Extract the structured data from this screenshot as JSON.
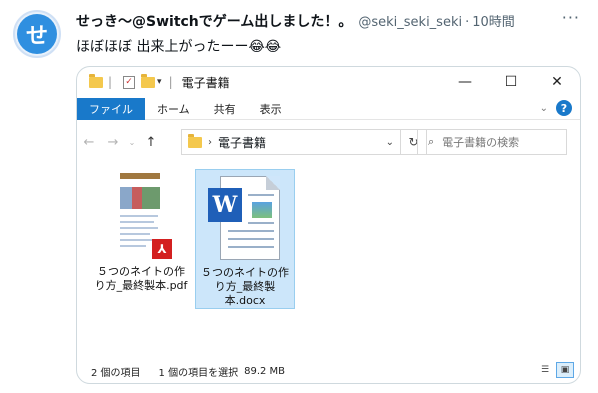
{
  "tweet": {
    "avatar_glyph": "せ",
    "display_name": "せっき～@Switchでゲーム出しました！。",
    "handle": "@seki_seki_seki",
    "separator": "·",
    "time": "10時間",
    "more": "···",
    "text": "ほぼほぼ 出来上がったーー😂😂"
  },
  "explorer": {
    "title": "電子書籍",
    "quick_access_sep": "|",
    "window_controls": {
      "minimize": "—",
      "maximize": "☐",
      "close": "✕"
    },
    "ribbon": {
      "tabs": [
        "ファイル",
        "ホーム",
        "共有",
        "表示"
      ],
      "expand": "⌄",
      "help": "?"
    },
    "nav": {
      "back": "←",
      "forward": "→",
      "recent": "⌄",
      "up": "↑",
      "address_chevron": "›",
      "address_text": "電子書籍",
      "address_dropdown": "⌄",
      "refresh": "↻",
      "search_placeholder": "電子書籍の検索"
    },
    "files": [
      {
        "name": "５つのネイトの作り方_最終製本.pdf",
        "type": "pdf",
        "selected": false
      },
      {
        "name": "５つのネイトの作り方_最終製本.docx",
        "type": "docx",
        "selected": true
      }
    ],
    "status": {
      "item_count": "2 個の項目",
      "selection": "1 個の項目を選択",
      "size": "89.2 MB"
    }
  },
  "colors": {
    "accent": "#1979ca",
    "selection": "#cce6fa",
    "word_blue": "#1f5fb8",
    "pdf_red": "#d32020"
  }
}
